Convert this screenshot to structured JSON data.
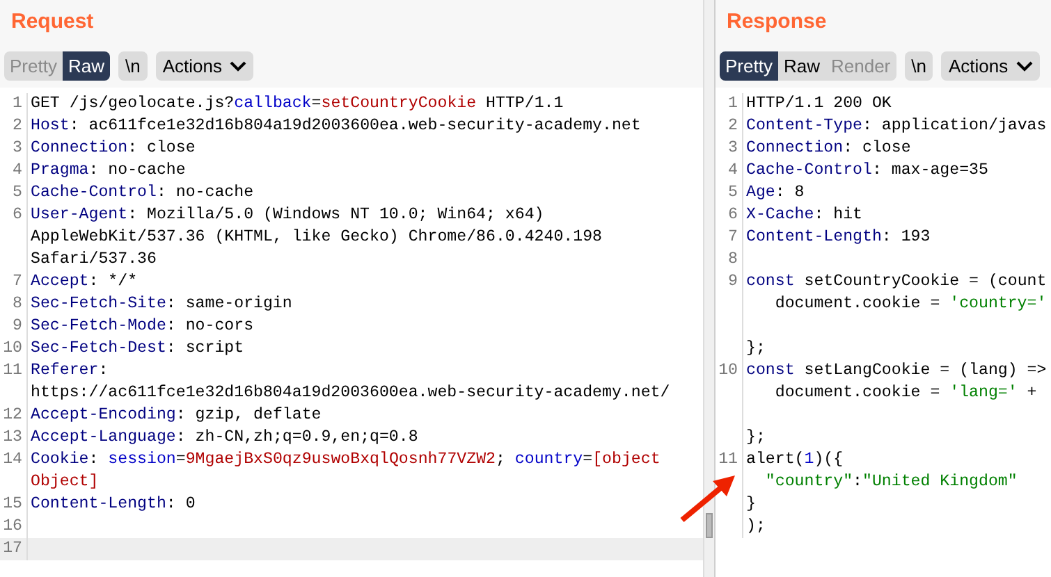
{
  "request": {
    "title": "Request",
    "view_tabs": [
      {
        "label": "Pretty",
        "selected": false,
        "disabled": true
      },
      {
        "label": "Raw",
        "selected": true,
        "disabled": false
      }
    ],
    "newline_button": "\\n",
    "actions_button": "Actions",
    "lines": [
      {
        "number": "1",
        "highlighted": false,
        "rows": [
          {
            "segments": [
              {
                "kind": "text",
                "text": "GET /js/geolocate.js?"
              },
              {
                "kind": "param",
                "text": "callback"
              },
              {
                "kind": "text",
                "text": "="
              },
              {
                "kind": "value",
                "text": "setCountryCookie"
              },
              {
                "kind": "text",
                "text": " HTTP/1.1"
              }
            ]
          }
        ]
      },
      {
        "number": "2",
        "highlighted": false,
        "rows": [
          {
            "segments": [
              {
                "kind": "header",
                "text": "Host"
              },
              {
                "kind": "text",
                "text": ": ac611fce1e32d16b804a19d2003600ea.web-security-academy.net"
              }
            ]
          }
        ]
      },
      {
        "number": "3",
        "highlighted": false,
        "rows": [
          {
            "segments": [
              {
                "kind": "header",
                "text": "Connection"
              },
              {
                "kind": "text",
                "text": ": close"
              }
            ]
          }
        ]
      },
      {
        "number": "4",
        "highlighted": false,
        "rows": [
          {
            "segments": [
              {
                "kind": "header",
                "text": "Pragma"
              },
              {
                "kind": "text",
                "text": ": no-cache"
              }
            ]
          }
        ]
      },
      {
        "number": "5",
        "highlighted": false,
        "rows": [
          {
            "segments": [
              {
                "kind": "header",
                "text": "Cache-Control"
              },
              {
                "kind": "text",
                "text": ": no-cache"
              }
            ]
          }
        ]
      },
      {
        "number": "6",
        "highlighted": false,
        "rows": [
          {
            "segments": [
              {
                "kind": "header",
                "text": "User-Agent"
              },
              {
                "kind": "text",
                "text": ": Mozilla/5.0 (Windows NT 10.0; Win64; x64)"
              }
            ]
          },
          {
            "segments": [
              {
                "kind": "text",
                "text": "AppleWebKit/537.36 (KHTML, like Gecko) Chrome/86.0.4240.198"
              }
            ]
          },
          {
            "segments": [
              {
                "kind": "text",
                "text": "Safari/537.36"
              }
            ]
          }
        ]
      },
      {
        "number": "7",
        "highlighted": false,
        "rows": [
          {
            "segments": [
              {
                "kind": "header",
                "text": "Accept"
              },
              {
                "kind": "text",
                "text": ": */*"
              }
            ]
          }
        ]
      },
      {
        "number": "8",
        "highlighted": false,
        "rows": [
          {
            "segments": [
              {
                "kind": "header",
                "text": "Sec-Fetch-Site"
              },
              {
                "kind": "text",
                "text": ": same-origin"
              }
            ]
          }
        ]
      },
      {
        "number": "9",
        "highlighted": false,
        "rows": [
          {
            "segments": [
              {
                "kind": "header",
                "text": "Sec-Fetch-Mode"
              },
              {
                "kind": "text",
                "text": ": no-cors"
              }
            ]
          }
        ]
      },
      {
        "number": "10",
        "highlighted": false,
        "rows": [
          {
            "segments": [
              {
                "kind": "header",
                "text": "Sec-Fetch-Dest"
              },
              {
                "kind": "text",
                "text": ": script"
              }
            ]
          }
        ]
      },
      {
        "number": "11",
        "highlighted": false,
        "rows": [
          {
            "segments": [
              {
                "kind": "header",
                "text": "Referer"
              },
              {
                "kind": "text",
                "text": ":"
              }
            ]
          },
          {
            "segments": [
              {
                "kind": "text",
                "text": "https://ac611fce1e32d16b804a19d2003600ea.web-security-academy.net/"
              }
            ]
          }
        ]
      },
      {
        "number": "12",
        "highlighted": false,
        "rows": [
          {
            "segments": [
              {
                "kind": "header",
                "text": "Accept-Encoding"
              },
              {
                "kind": "text",
                "text": ": gzip, deflate"
              }
            ]
          }
        ]
      },
      {
        "number": "13",
        "highlighted": false,
        "rows": [
          {
            "segments": [
              {
                "kind": "header",
                "text": "Accept-Language"
              },
              {
                "kind": "text",
                "text": ": zh-CN,zh;q=0.9,en;q=0.8"
              }
            ]
          }
        ]
      },
      {
        "number": "14",
        "highlighted": false,
        "rows": [
          {
            "segments": [
              {
                "kind": "header",
                "text": "Cookie"
              },
              {
                "kind": "text",
                "text": ": "
              },
              {
                "kind": "param",
                "text": "session"
              },
              {
                "kind": "text",
                "text": "="
              },
              {
                "kind": "value",
                "text": "9MgaejBxS0qz9uswoBxqlQosnh77VZW2"
              },
              {
                "kind": "text",
                "text": "; "
              },
              {
                "kind": "param",
                "text": "country"
              },
              {
                "kind": "text",
                "text": "="
              },
              {
                "kind": "value",
                "text": "[object"
              }
            ]
          },
          {
            "segments": [
              {
                "kind": "value",
                "text": "Object]"
              }
            ]
          }
        ]
      },
      {
        "number": "15",
        "highlighted": false,
        "rows": [
          {
            "segments": [
              {
                "kind": "header",
                "text": "Content-Length"
              },
              {
                "kind": "text",
                "text": ": 0"
              }
            ]
          }
        ]
      },
      {
        "number": "16",
        "highlighted": false
      },
      {
        "number": "17",
        "highlighted": true
      }
    ]
  },
  "response": {
    "title": "Response",
    "view_tabs": [
      {
        "label": "Pretty",
        "selected": true,
        "disabled": false
      },
      {
        "label": "Raw",
        "selected": false,
        "disabled": false
      },
      {
        "label": "Render",
        "selected": false,
        "disabled": true
      }
    ],
    "newline_button": "\\n",
    "actions_button": "Actions",
    "lines": [
      {
        "number": "1",
        "highlighted": false,
        "rows": [
          {
            "segments": [
              {
                "kind": "text",
                "text": "HTTP/1.1 200 OK"
              }
            ]
          }
        ]
      },
      {
        "number": "2",
        "highlighted": false,
        "rows": [
          {
            "segments": [
              {
                "kind": "header",
                "text": "Content-Type"
              },
              {
                "kind": "text",
                "text": ": application/javas"
              }
            ]
          }
        ]
      },
      {
        "number": "3",
        "highlighted": false,
        "rows": [
          {
            "segments": [
              {
                "kind": "header",
                "text": "Connection"
              },
              {
                "kind": "text",
                "text": ": close"
              }
            ]
          }
        ]
      },
      {
        "number": "4",
        "highlighted": false,
        "rows": [
          {
            "segments": [
              {
                "kind": "header",
                "text": "Cache-Control"
              },
              {
                "kind": "text",
                "text": ": max-age=35"
              }
            ]
          }
        ]
      },
      {
        "number": "5",
        "highlighted": false,
        "rows": [
          {
            "segments": [
              {
                "kind": "header",
                "text": "Age"
              },
              {
                "kind": "text",
                "text": ": 8"
              }
            ]
          }
        ]
      },
      {
        "number": "6",
        "highlighted": false,
        "rows": [
          {
            "segments": [
              {
                "kind": "header",
                "text": "X-Cache"
              },
              {
                "kind": "text",
                "text": ": hit"
              }
            ]
          }
        ]
      },
      {
        "number": "7",
        "highlighted": false,
        "rows": [
          {
            "segments": [
              {
                "kind": "header",
                "text": "Content-Length"
              },
              {
                "kind": "text",
                "text": ": 193"
              }
            ]
          }
        ]
      },
      {
        "number": "8",
        "highlighted": false
      },
      {
        "number": "9",
        "highlighted": false,
        "rows": [
          {
            "segments": [
              {
                "kind": "header",
                "text": "const"
              },
              {
                "kind": "text",
                "text": " setCountryCookie = (count"
              }
            ]
          },
          {
            "segments": [
              {
                "kind": "text",
                "text": "   document.cookie = "
              },
              {
                "kind": "string",
                "text": "'country='"
              }
            ]
          },
          {},
          {
            "segments": [
              {
                "kind": "text",
                "text": "};"
              }
            ]
          }
        ]
      },
      {
        "number": "10",
        "highlighted": false,
        "rows": [
          {
            "segments": [
              {
                "kind": "header",
                "text": "const"
              },
              {
                "kind": "text",
                "text": " setLangCookie = (lang) =>"
              }
            ]
          },
          {
            "segments": [
              {
                "kind": "text",
                "text": "   document.cookie = "
              },
              {
                "kind": "string",
                "text": "'lang='"
              },
              {
                "kind": "text",
                "text": " +"
              }
            ]
          },
          {},
          {
            "segments": [
              {
                "kind": "text",
                "text": "};"
              }
            ]
          }
        ]
      },
      {
        "number": "11",
        "highlighted": false,
        "rows": [
          {
            "segments": [
              {
                "kind": "text",
                "text": "alert("
              },
              {
                "kind": "param",
                "text": "1"
              },
              {
                "kind": "text",
                "text": ")({"
              }
            ]
          },
          {
            "segments": [
              {
                "kind": "string",
                "text": "  \"country\""
              },
              {
                "kind": "text",
                "text": ":"
              },
              {
                "kind": "string",
                "text": "\"United Kingdom\""
              }
            ]
          },
          {
            "segments": [
              {
                "kind": "text",
                "text": "}"
              }
            ]
          },
          {
            "segments": [
              {
                "kind": "text",
                "text": ");"
              }
            ]
          }
        ]
      }
    ]
  }
}
